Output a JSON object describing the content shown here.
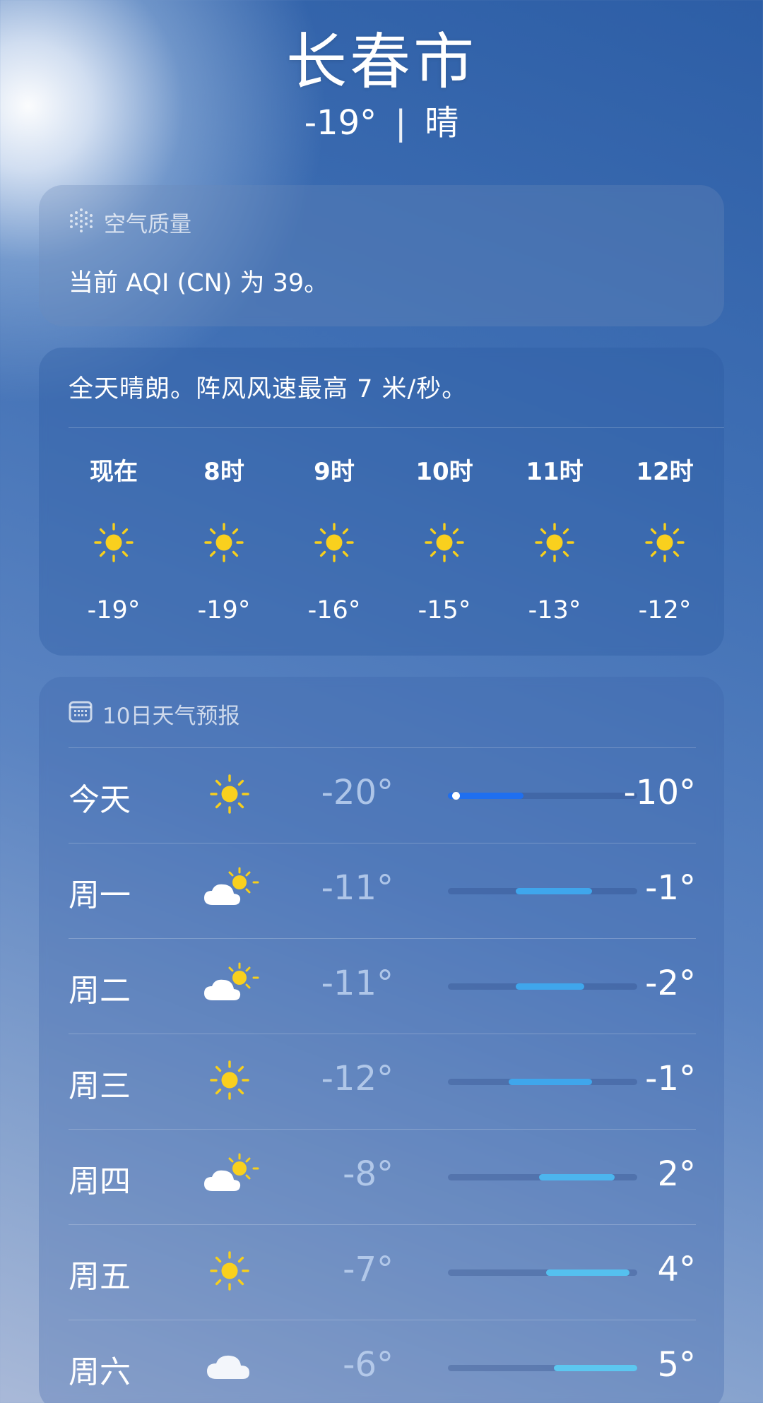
{
  "header": {
    "city": "长春市",
    "temp": "-19°",
    "separator": "|",
    "condition": "晴"
  },
  "air_quality": {
    "title": "空气质量",
    "icon": "air-quality-dots-icon",
    "text": "当前 AQI (CN) 为 39。"
  },
  "hourly": {
    "description": "全天晴朗。阵风风速最高 7 米/秒。",
    "items": [
      {
        "label": "现在",
        "icon": "sun-icon",
        "temp": "-19°"
      },
      {
        "label": "8时",
        "icon": "sun-icon",
        "temp": "-19°"
      },
      {
        "label": "9时",
        "icon": "sun-icon",
        "temp": "-16°"
      },
      {
        "label": "10时",
        "icon": "sun-icon",
        "temp": "-15°"
      },
      {
        "label": "11时",
        "icon": "sun-icon",
        "temp": "-13°"
      },
      {
        "label": "12时",
        "icon": "sun-icon",
        "temp": "-12°"
      }
    ]
  },
  "forecast": {
    "title": "10日天气预报",
    "icon": "calendar-icon",
    "range_min": -20,
    "range_max": 5,
    "days": [
      {
        "name": "今天",
        "icon": "sun-icon",
        "low": "-20°",
        "high": "-10°",
        "lo": -20,
        "hi": -10,
        "current": -19,
        "color": "#1f6ff0"
      },
      {
        "name": "周一",
        "icon": "partly-cloudy-icon",
        "low": "-11°",
        "high": "-1°",
        "lo": -11,
        "hi": -1,
        "color": "#3fa6ec"
      },
      {
        "name": "周二",
        "icon": "partly-cloudy-icon",
        "low": "-11°",
        "high": "-2°",
        "lo": -11,
        "hi": -2,
        "color": "#3fa6ec"
      },
      {
        "name": "周三",
        "icon": "sun-icon",
        "low": "-12°",
        "high": "-1°",
        "lo": -12,
        "hi": -1,
        "color": "#3fa6ec"
      },
      {
        "name": "周四",
        "icon": "partly-cloudy-icon",
        "low": "-8°",
        "high": "2°",
        "lo": -8,
        "hi": 2,
        "color": "#4cb5ee"
      },
      {
        "name": "周五",
        "icon": "sun-icon",
        "low": "-7°",
        "high": "4°",
        "lo": -7,
        "hi": 4,
        "color": "#55c0ef"
      },
      {
        "name": "周六",
        "icon": "cloud-icon",
        "low": "-6°",
        "high": "5°",
        "lo": -6,
        "hi": 5,
        "color": "#5cc7f0"
      }
    ]
  }
}
